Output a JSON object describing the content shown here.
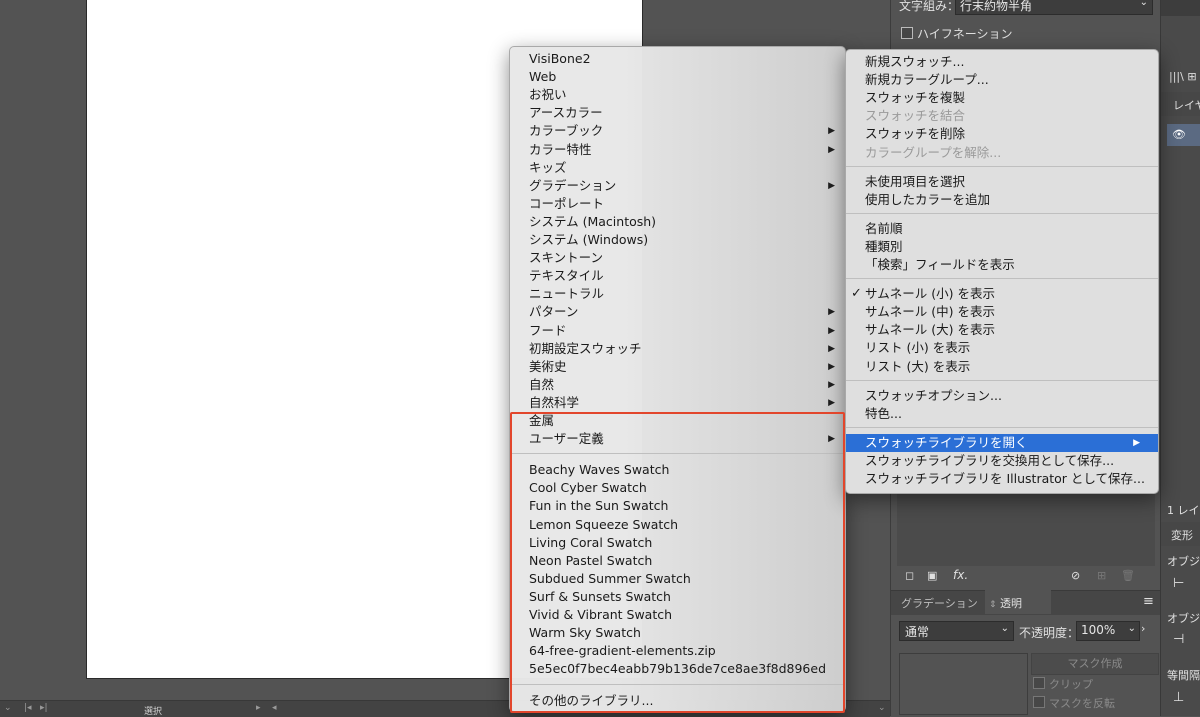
{
  "top_right": {
    "composition_label": "文字組み：",
    "composition_value": "行末約物半角",
    "hyphenation_label": "ハイフネーション",
    "layers_tab": "レイヤ",
    "layers_count": "1 レイ",
    "transform_tab": "変形",
    "objects_label1": "オブジ",
    "objects_label2": "オブジ",
    "spacing_label": "等間隔"
  },
  "transparency_panel": {
    "tab_gradient": "グラデーション",
    "tab_transparency": "透明",
    "blend_mode": "通常",
    "opacity_label": "不透明度：",
    "opacity_value": "100%",
    "mask_button": "マスク作成",
    "clip_label": "クリップ",
    "invert_label": "マスクを反転"
  },
  "status": {
    "mode": "選択"
  },
  "library_menu": {
    "items": [
      {
        "label": "VisiBone2",
        "submenu": false
      },
      {
        "label": "Web",
        "submenu": false
      },
      {
        "label": "お祝い",
        "submenu": false
      },
      {
        "label": "アースカラー",
        "submenu": false
      },
      {
        "label": "カラーブック",
        "submenu": true
      },
      {
        "label": "カラー特性",
        "submenu": true
      },
      {
        "label": "キッズ",
        "submenu": false
      },
      {
        "label": "グラデーション",
        "submenu": true
      },
      {
        "label": "コーポレート",
        "submenu": false
      },
      {
        "label": "システム (Macintosh)",
        "submenu": false
      },
      {
        "label": "システム (Windows)",
        "submenu": false
      },
      {
        "label": "スキントーン",
        "submenu": false
      },
      {
        "label": "テキスタイル",
        "submenu": false
      },
      {
        "label": "ニュートラル",
        "submenu": false
      },
      {
        "label": "パターン",
        "submenu": true
      },
      {
        "label": "フード",
        "submenu": true
      },
      {
        "label": "初期設定スウォッチ",
        "submenu": true
      },
      {
        "label": "美術史",
        "submenu": true
      },
      {
        "label": "自然",
        "submenu": true
      },
      {
        "label": "自然科学",
        "submenu": true
      },
      {
        "label": "金属",
        "submenu": false
      },
      {
        "label": "ユーザー定義",
        "submenu": true
      }
    ],
    "user_items": [
      "Beachy Waves Swatch",
      "Cool Cyber Swatch",
      "Fun in the Sun Swatch",
      "Lemon Squeeze Swatch",
      "Living Coral Swatch",
      "Neon Pastel Swatch",
      "Subdued Summer Swatch",
      "Surf & Sunsets Swatch",
      "Vivid & Vibrant Swatch",
      "Warm Sky Swatch",
      "64-free-gradient-elements.zip",
      "5e5ec0f7bec4eabb79b136de7ce8ae3f8d896ed"
    ],
    "other_libraries": "その他のライブラリ..."
  },
  "swatch_menu": {
    "group1": [
      {
        "label": "新規スウォッチ...",
        "disabled": false
      },
      {
        "label": "新規カラーグループ...",
        "disabled": false
      },
      {
        "label": "スウォッチを複製",
        "disabled": false
      },
      {
        "label": "スウォッチを結合",
        "disabled": true
      },
      {
        "label": "スウォッチを削除",
        "disabled": false
      },
      {
        "label": "カラーグループを解除...",
        "disabled": true
      }
    ],
    "group2": [
      "未使用項目を選択",
      "使用したカラーを追加"
    ],
    "group3": [
      "名前順",
      "種類別",
      "「検索」フィールドを表示"
    ],
    "group4": [
      {
        "label": "サムネール (小) を表示",
        "checked": true
      },
      {
        "label": "サムネール (中) を表示",
        "checked": false
      },
      {
        "label": "サムネール (大) を表示",
        "checked": false
      },
      {
        "label": "リスト (小) を表示",
        "checked": false
      },
      {
        "label": "リスト (大) を表示",
        "checked": false
      }
    ],
    "group5": [
      "スウォッチオプション...",
      "特色..."
    ],
    "group6": [
      {
        "label": "スウォッチライブラリを開く",
        "highlight": true,
        "submenu": true
      },
      {
        "label": "スウォッチライブラリを交換用として保存...",
        "highlight": false,
        "submenu": false
      },
      {
        "label": "スウォッチライブラリを Illustrator として保存...",
        "highlight": false,
        "submenu": false
      }
    ]
  },
  "colors": {
    "highlight": "#2b6fd6",
    "annotation": "#e2462c",
    "panel": "#535353"
  }
}
